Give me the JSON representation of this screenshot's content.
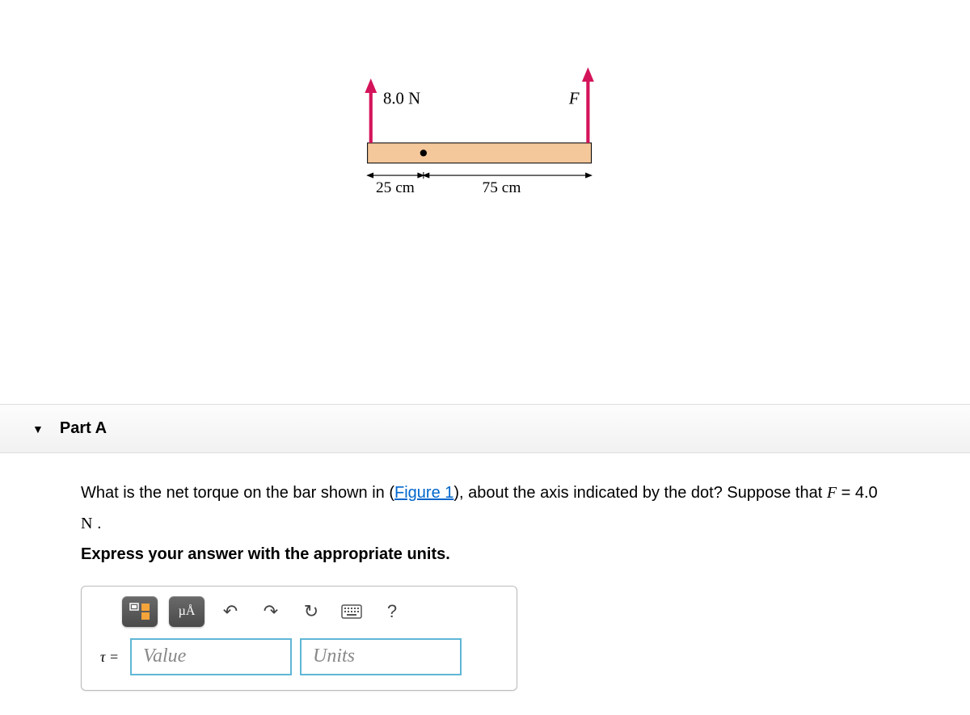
{
  "figure": {
    "force1_label": "8.0 N",
    "force2_label": "F",
    "dim1_label": "25 cm",
    "dim2_label": "75 cm"
  },
  "part": {
    "title": "Part A"
  },
  "question": {
    "pre": "What is the net torque on the bar shown in (",
    "link_text": "Figure 1",
    "mid": "), about the axis indicated by the dot? Suppose that ",
    "var": "F",
    "eq": " = 4.0  ",
    "unit": "N",
    "post": " .",
    "instruction": "Express your answer with the appropriate units."
  },
  "toolbar": {
    "units_btn": "µÅ",
    "help": "?"
  },
  "answer": {
    "tau_label": "τ =",
    "value_placeholder": "Value",
    "units_placeholder": "Units"
  }
}
